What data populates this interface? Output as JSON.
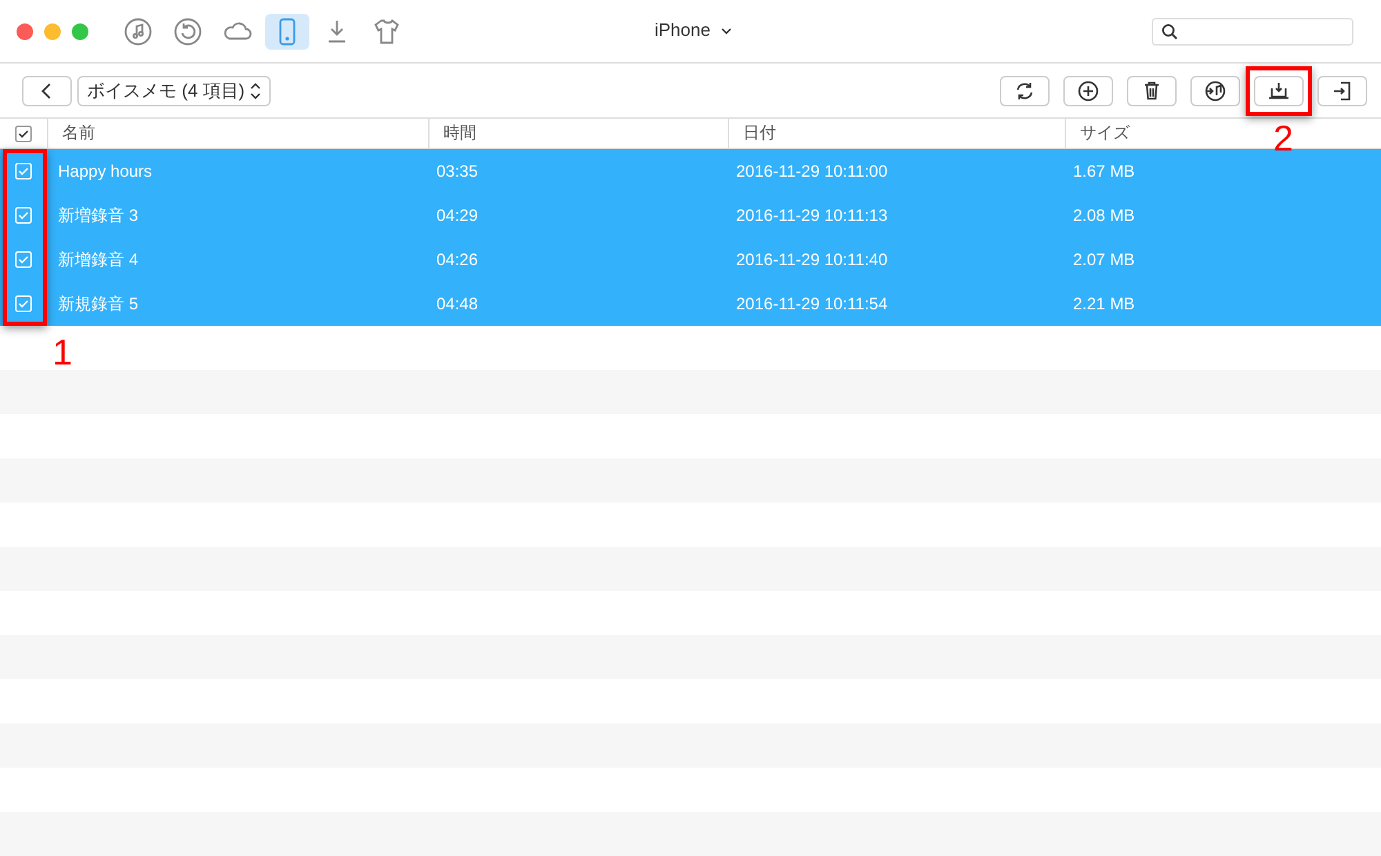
{
  "window": {
    "device": "iPhone"
  },
  "nav_icons": [
    {
      "kind": "music",
      "selected": false
    },
    {
      "kind": "restore",
      "selected": false
    },
    {
      "kind": "cloud",
      "selected": false
    },
    {
      "kind": "phone",
      "selected": true
    },
    {
      "kind": "download",
      "selected": false
    },
    {
      "kind": "shirt",
      "selected": false
    }
  ],
  "toolbar": {
    "category": "ボイスメモ (4 項目)",
    "buttons": [
      {
        "kind": "refresh"
      },
      {
        "kind": "add"
      },
      {
        "kind": "delete"
      },
      {
        "kind": "to-itunes"
      },
      {
        "kind": "export",
        "annotation": "2"
      },
      {
        "kind": "to-device"
      }
    ]
  },
  "table": {
    "all_checked": true,
    "checkbox_annotation": "1",
    "columns": [
      "名前",
      "時間",
      "日付",
      "サイズ"
    ],
    "rows": [
      {
        "checked": true,
        "selected": true,
        "cells": [
          "Happy hours",
          "03:35",
          "2016-11-29 10:11:00",
          "1.67 MB"
        ]
      },
      {
        "checked": true,
        "selected": true,
        "cells": [
          "新増錄音 3",
          "04:29",
          "2016-11-29 10:11:13",
          "2.08 MB"
        ]
      },
      {
        "checked": true,
        "selected": true,
        "cells": [
          "新增錄音 4",
          "04:26",
          "2016-11-29 10:11:40",
          "2.07 MB"
        ]
      },
      {
        "checked": true,
        "selected": true,
        "cells": [
          "新規錄音 5",
          "04:48",
          "2016-11-29 10:11:54",
          "2.21 MB"
        ]
      }
    ]
  }
}
